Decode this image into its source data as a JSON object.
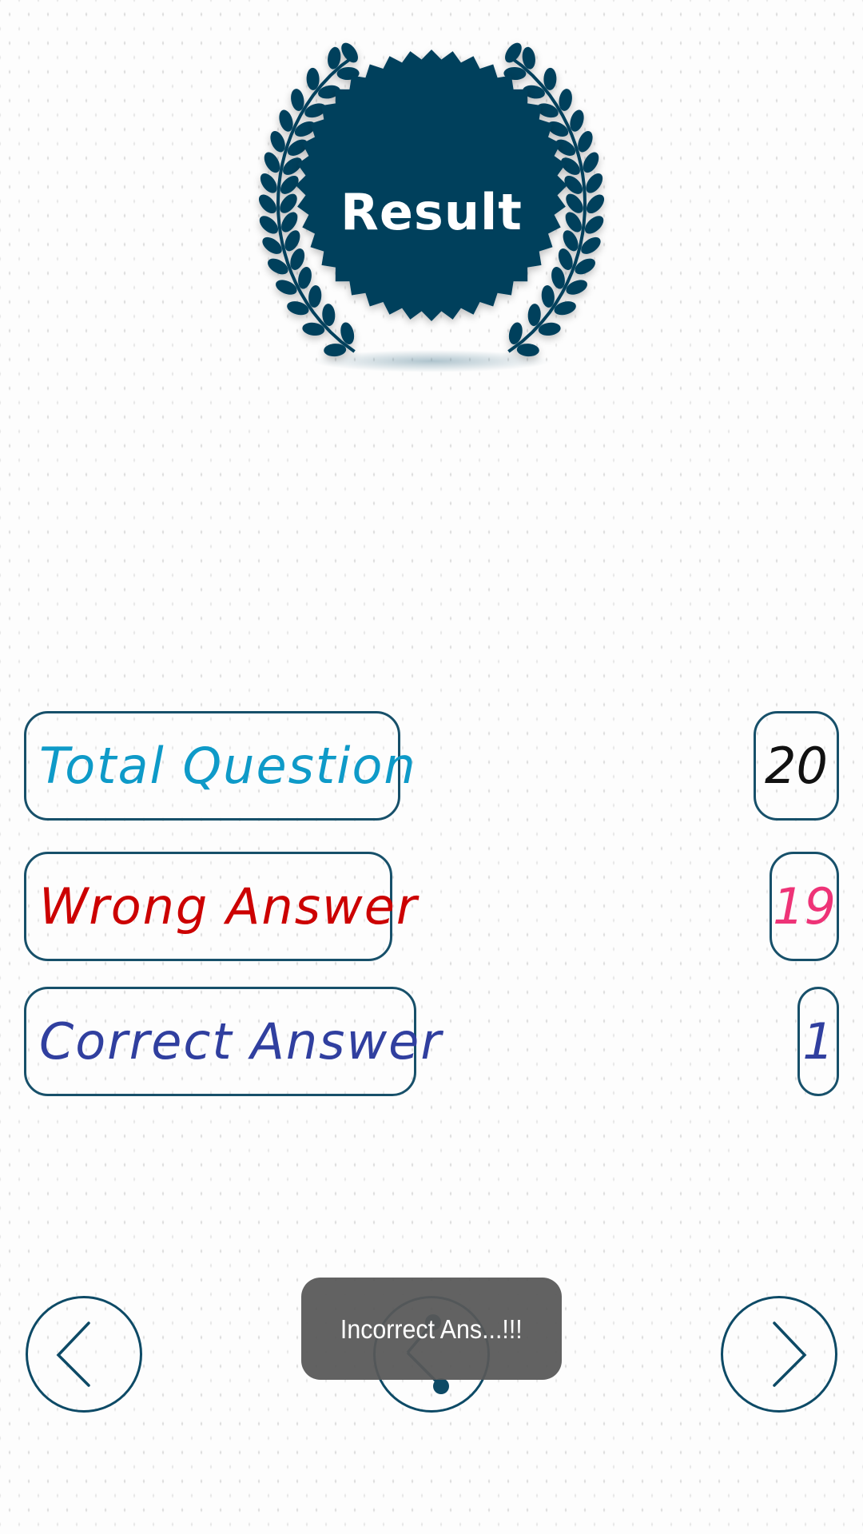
{
  "badge": {
    "title": "Result",
    "icon": "laurel-seal-icon",
    "color": "#053f5c"
  },
  "stats": [
    {
      "key": "total",
      "label": "Total Question",
      "value": "20",
      "label_color": "#0e9ac8",
      "value_color": "#111111"
    },
    {
      "key": "wrong",
      "label": "Wrong Answer",
      "value": "19",
      "label_color": "#cc0000",
      "value_color": "#ee3377"
    },
    {
      "key": "correct",
      "label": "Correct Answer",
      "value": "1",
      "label_color": "#303f9f",
      "value_color": "#303f9f"
    }
  ],
  "nav": {
    "prev_icon": "chevron-left-icon",
    "share_icon": "share-icon",
    "next_icon": "chevron-right-icon",
    "border_color": "#0d4a66"
  },
  "toast": {
    "message": "Incorrect Ans...!!!"
  }
}
